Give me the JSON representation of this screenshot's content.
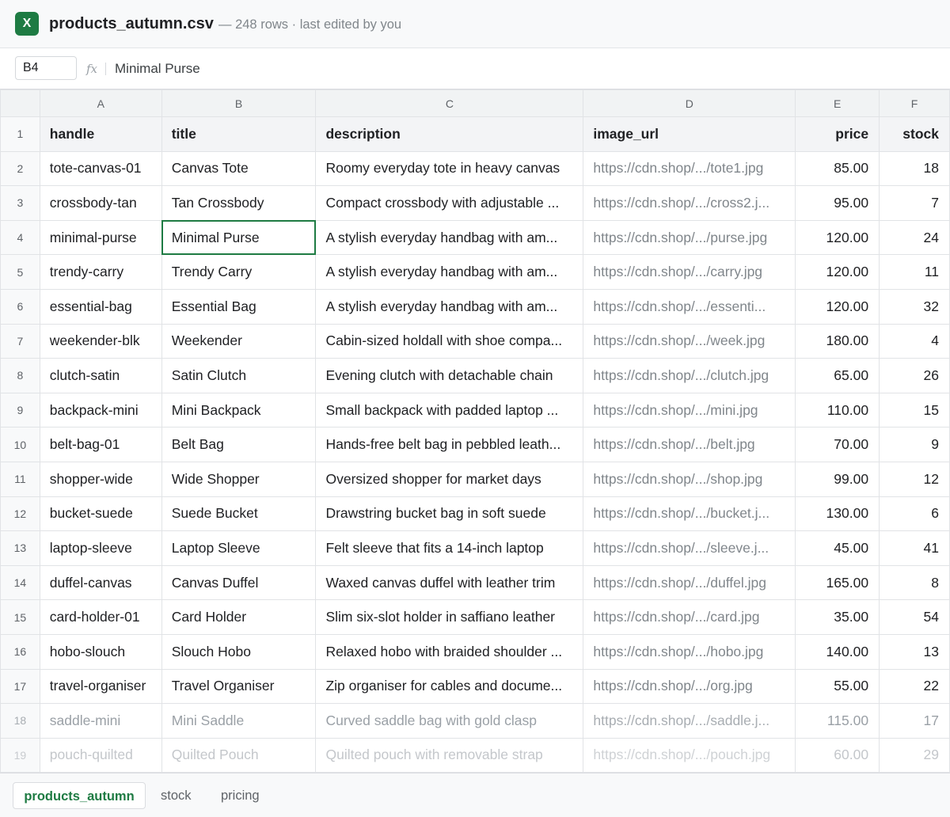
{
  "header": {
    "app_icon": "X",
    "file_name": "products_autumn.csv",
    "meta": "— 248 rows · last edited by you"
  },
  "formula_bar": {
    "cell_ref": "B4",
    "fx": "fx",
    "value": "Minimal Purse"
  },
  "grid": {
    "columns": [
      "A",
      "B",
      "C",
      "D",
      "E",
      "F"
    ],
    "header_row": {
      "num": "1",
      "cells": [
        "handle",
        "title",
        "description",
        "image_url",
        "price",
        "stock"
      ]
    },
    "rows": [
      {
        "num": "2",
        "cells": [
          "tote-canvas-01",
          "Canvas Tote",
          "Roomy everyday tote in heavy canvas",
          "https://cdn.shop/.../tote1.jpg",
          "85.00",
          "18"
        ]
      },
      {
        "num": "3",
        "cells": [
          "crossbody-tan",
          "Tan Crossbody",
          "Compact crossbody with adjustable ...",
          "https://cdn.shop/.../cross2.j...",
          "95.00",
          "7"
        ]
      },
      {
        "num": "4",
        "cells": [
          "minimal-purse",
          "Minimal Purse",
          "A stylish everyday handbag with am...",
          "https://cdn.shop/.../purse.jpg",
          "120.00",
          "24"
        ]
      },
      {
        "num": "5",
        "cells": [
          "trendy-carry",
          "Trendy Carry",
          "A stylish everyday handbag with am...",
          "https://cdn.shop/.../carry.jpg",
          "120.00",
          "11"
        ]
      },
      {
        "num": "6",
        "cells": [
          "essential-bag",
          "Essential Bag",
          "A stylish everyday handbag with am...",
          "https://cdn.shop/.../essenti...",
          "120.00",
          "32"
        ]
      },
      {
        "num": "7",
        "cells": [
          "weekender-blk",
          "Weekender",
          "Cabin-sized holdall with shoe compa...",
          "https://cdn.shop/.../week.jpg",
          "180.00",
          "4"
        ]
      },
      {
        "num": "8",
        "cells": [
          "clutch-satin",
          "Satin Clutch",
          "Evening clutch with detachable chain",
          "https://cdn.shop/.../clutch.jpg",
          "65.00",
          "26"
        ]
      },
      {
        "num": "9",
        "cells": [
          "backpack-mini",
          "Mini Backpack",
          "Small backpack with padded laptop ...",
          "https://cdn.shop/.../mini.jpg",
          "110.00",
          "15"
        ]
      },
      {
        "num": "10",
        "cells": [
          "belt-bag-01",
          "Belt Bag",
          "Hands-free belt bag in pebbled leath...",
          "https://cdn.shop/.../belt.jpg",
          "70.00",
          "9"
        ]
      },
      {
        "num": "11",
        "cells": [
          "shopper-wide",
          "Wide Shopper",
          "Oversized shopper for market days",
          "https://cdn.shop/.../shop.jpg",
          "99.00",
          "12"
        ]
      },
      {
        "num": "12",
        "cells": [
          "bucket-suede",
          "Suede Bucket",
          "Drawstring bucket bag in soft suede",
          "https://cdn.shop/.../bucket.j...",
          "130.00",
          "6"
        ]
      },
      {
        "num": "13",
        "cells": [
          "laptop-sleeve",
          "Laptop Sleeve",
          "Felt sleeve that fits a 14-inch laptop",
          "https://cdn.shop/.../sleeve.j...",
          "45.00",
          "41"
        ]
      },
      {
        "num": "14",
        "cells": [
          "duffel-canvas",
          "Canvas Duffel",
          "Waxed canvas duffel with leather trim",
          "https://cdn.shop/.../duffel.jpg",
          "165.00",
          "8"
        ]
      },
      {
        "num": "15",
        "cells": [
          "card-holder-01",
          "Card Holder",
          "Slim six-slot holder in saffiano leather",
          "https://cdn.shop/.../card.jpg",
          "35.00",
          "54"
        ]
      },
      {
        "num": "16",
        "cells": [
          "hobo-slouch",
          "Slouch Hobo",
          "Relaxed hobo with braided shoulder ...",
          "https://cdn.shop/.../hobo.jpg",
          "140.00",
          "13"
        ]
      },
      {
        "num": "17",
        "cells": [
          "travel-organiser",
          "Travel Organiser",
          "Zip organiser for cables and docume...",
          "https://cdn.shop/.../org.jpg",
          "55.00",
          "22"
        ]
      },
      {
        "num": "18",
        "cells": [
          "saddle-mini",
          "Mini Saddle",
          "Curved saddle bag with gold clasp",
          "https://cdn.shop/.../saddle.j...",
          "115.00",
          "17"
        ]
      },
      {
        "num": "19",
        "cells": [
          "pouch-quilted",
          "Quilted Pouch",
          "Quilted pouch with removable strap",
          "https://cdn.shop/.../pouch.jpg",
          "60.00",
          "29"
        ]
      }
    ]
  },
  "tabs": [
    "products_autumn",
    "stock",
    "pricing"
  ],
  "colors": {
    "accent": "#1e7b43",
    "header_bg": "#f8f9fa",
    "grid_line": "#e1e3e6",
    "muted_text": "#80868b"
  }
}
